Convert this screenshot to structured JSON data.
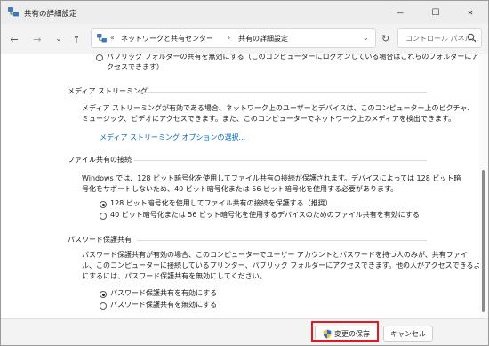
{
  "window": {
    "title": "共有の詳細設定",
    "minimize": "—",
    "maximize": "☐",
    "close": "✕"
  },
  "nav": {
    "back": "←",
    "forward": "→",
    "recent": "⌄",
    "up": "↑",
    "chevron": "«",
    "crumbs": [
      "ネットワークと共有センター",
      "共有の詳細設定"
    ],
    "separator": "›",
    "dropdown": "⌄",
    "refresh": "↻",
    "search_placeholder": "コントロール パネル..."
  },
  "top_partial": {
    "line1": "パブリック フォルダーの共有を無効にする（このコンピューターにログオンしている場合はこれらのフォルダーにア",
    "line2": "クセスできます）"
  },
  "media": {
    "header": "メディア ストリーミング",
    "desc1": "メディア ストリーミングが有効である場合、ネットワーク上のユーザーとデバイスは、このコンピューター上のピクチャ、",
    "desc2": "ミュージック、ビデオにアクセスできます。また、このコンピューターでネットワーク上のメディアを検出できます。",
    "link": "メディア ストリーミング オプションの選択..."
  },
  "file_sharing": {
    "header": "ファイル共有の接続",
    "desc1": "Windows では、128 ビット暗号化を使用してファイル共有の接続が保護されます。デバイスによっては 128 ビット暗",
    "desc2": "号化をサポートしないため、40 ビット暗号化または 56 ビット暗号化を使用する必要があります。",
    "option1": "128 ビット暗号化を使用してファイル共有の接続を保護する（推奨）",
    "option2": "40 ビット暗号化または 56 ビット暗号化を使用するデバイスのためのファイル共有を有効にする",
    "selected": 1
  },
  "password": {
    "header": "パスワード保護共有",
    "desc1": "パスワード保護共有が有効の場合、このコンピューターでユーザー アカウントとパスワードを持つ人のみが、共有ファイ",
    "desc2": "ル、このコンピューターに接続しているプリンター、パブリック フォルダーにアクセスできます。他の人がアクセスできるよう",
    "desc3": "にするには、パスワード保護共有を無効にしてください。",
    "option1": "パスワード保護共有を有効にする",
    "option2": "パスワード保護共有を無効にする",
    "selected": 1
  },
  "footer": {
    "save_label": "変更の保存",
    "cancel_label": "キャンセル"
  }
}
